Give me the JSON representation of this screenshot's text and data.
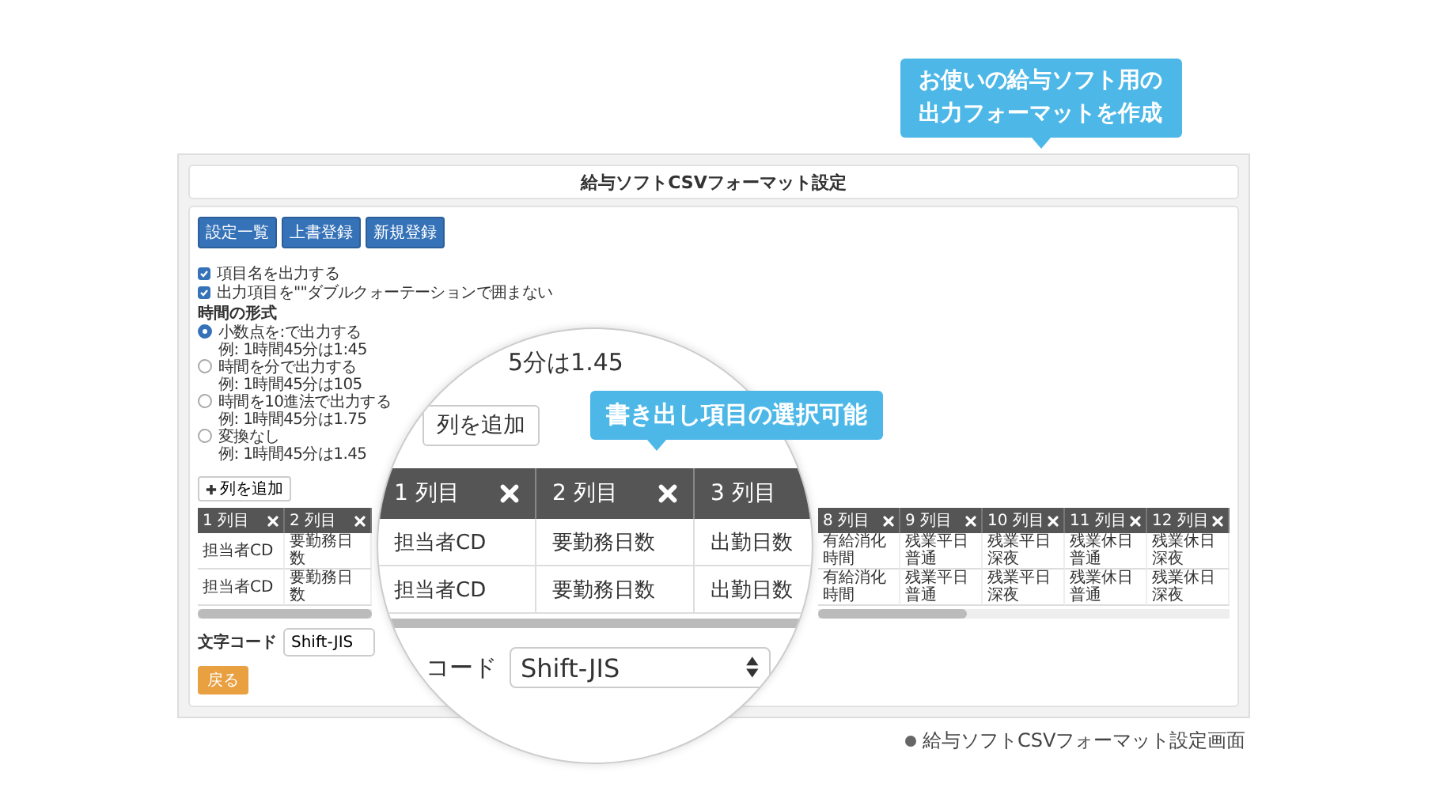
{
  "top_callout": {
    "lines": [
      "お使いの給与ソフト用の",
      "出力フォーマットを作成"
    ]
  },
  "window": {
    "title": "給与ソフトCSVフォーマット設定"
  },
  "toolbar": [
    "設定一覧",
    "上書登録",
    "新規登録"
  ],
  "options": [
    {
      "label": "項目名を出力する",
      "checked": true
    },
    {
      "label": "出力項目を\"\"ダブルクォーテーションで囲まない",
      "checked": true
    }
  ],
  "time_format": {
    "heading": "時間の形式",
    "choices": [
      {
        "label": "小数点を:で出力する",
        "example": "例: 1時間45分は1:45",
        "selected": true
      },
      {
        "label": "時間を分で出力する",
        "example": "例: 1時間45分は105",
        "selected": false
      },
      {
        "label": "時間を10進法で出力する",
        "example": "例: 1時間45分は1.75",
        "selected": false
      },
      {
        "label": "変換なし",
        "example": "例: 1時間45分は1.45",
        "selected": false
      }
    ]
  },
  "add_column_button": "列を追加",
  "table": {
    "columns": [
      {
        "label": "1 列目",
        "removable": true
      },
      {
        "label": "2 列目",
        "removable": true
      },
      {
        "label": "8 列目",
        "removable": true
      },
      {
        "label": "9 列目",
        "removable": true
      },
      {
        "label": "10 列目",
        "removable": true
      },
      {
        "label": "11 列目",
        "removable": true
      },
      {
        "label": "12 列目",
        "removable": true
      }
    ],
    "rows": [
      [
        "担当者CD",
        "要勤務日数",
        "有給消化時間",
        "残業平日普通",
        "残業平日深夜",
        "残業休日普通",
        "残業休日深夜"
      ],
      [
        "担当者CD",
        "要勤務日数",
        "有給消化時間",
        "残業平日普通",
        "残業平日深夜",
        "残業休日普通",
        "残業休日深夜"
      ]
    ]
  },
  "encoding": {
    "label": "文字コード",
    "value": "Shift-JIS"
  },
  "back_button": "戻る",
  "magnifier": {
    "note": "5分は1.45",
    "add_column_button": "列を追加",
    "callout": "書き出し項目の選択可能",
    "columns": [
      {
        "label": "1 列目",
        "removable": true
      },
      {
        "label": "2 列目",
        "removable": true
      },
      {
        "label": "3 列目"
      }
    ],
    "rows": [
      [
        "担当者CD",
        "要勤務日数",
        "出勤日数"
      ],
      [
        "担当者CD",
        "要勤務日数",
        "出勤日数"
      ]
    ],
    "encoding_label": "コード",
    "encoding_value": "Shift-JIS"
  },
  "caption": "給与ソフトCSVフォーマット設定画面"
}
